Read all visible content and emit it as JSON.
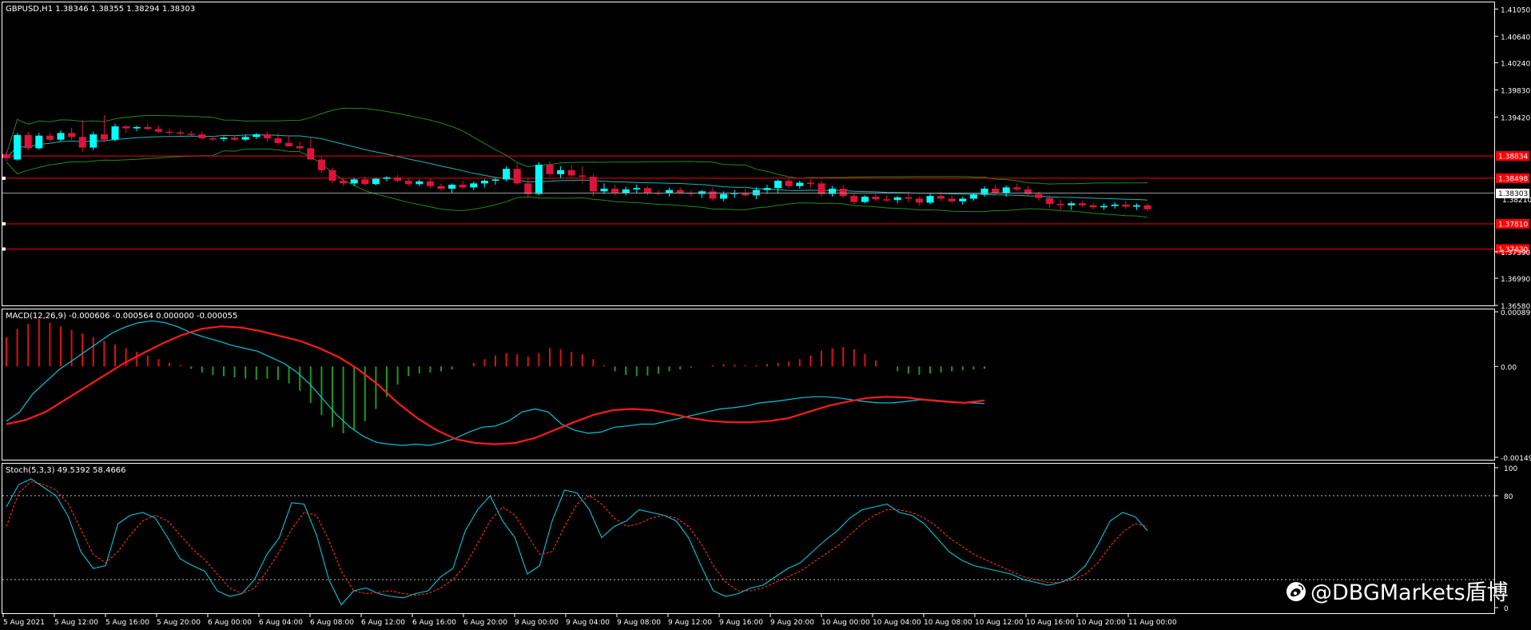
{
  "colors": {
    "bg": "#000000",
    "frame": "#ffffff",
    "bull": "#00ffff",
    "bear": "#dc143c",
    "bb": "#1f8a1f",
    "level": "#ff0000",
    "macd_main": "#00c8d8",
    "macd_signal": "#ff1a1a",
    "hist_pos": "#e01010",
    "hist_neg": "#1a9a1a",
    "stoch_main": "#00c8d8",
    "stoch_signal": "#ff2a2a"
  },
  "main_panel": {
    "header": "GBPUSD,H1  1.38346 1.38355 1.38294 1.38303",
    "price_ticks": [
      "1.41050",
      "1.40640",
      "1.40240",
      "1.39830",
      "1.39420",
      "1.37390",
      "1.36990",
      "1.36580"
    ],
    "current_price": "1.38303",
    "levels": [
      {
        "label": "1.38834",
        "price": 1.38834
      },
      {
        "label": "1.38498",
        "price": 1.38498
      },
      {
        "label": "1.37810",
        "price": 1.3781
      },
      {
        "label": "1.37430",
        "price": 1.3743
      }
    ],
    "hidden_tick": "1.38210"
  },
  "macd_panel": {
    "header": "MACD(12,26,9) -0.000606 -0.000564 0.000000 -0.000055",
    "ticks": [
      "0.000899",
      "0.00",
      "-0.001496"
    ]
  },
  "stoch_panel": {
    "header": "Stoch(5,3,3) 49.5392 58.4666",
    "ticks": [
      "100",
      "80",
      "0"
    ]
  },
  "time_axis": [
    "5 Aug 2021",
    "5 Aug 12:00",
    "5 Aug 16:00",
    "5 Aug 20:00",
    "6 Aug 00:00",
    "6 Aug 04:00",
    "6 Aug 08:00",
    "6 Aug 12:00",
    "6 Aug 16:00",
    "6 Aug 20:00",
    "9 Aug 00:00",
    "9 Aug 04:00",
    "9 Aug 08:00",
    "9 Aug 12:00",
    "9 Aug 16:00",
    "9 Aug 20:00",
    "10 Aug 00:00",
    "10 Aug 04:00",
    "10 Aug 08:00",
    "10 Aug 12:00",
    "10 Aug 16:00",
    "10 Aug 20:00",
    "11 Aug 00:00"
  ],
  "watermark": "@DBGMarkets盾博",
  "watermark_icon": "weibo-logo-icon",
  "chart_data": {
    "type": "candlestick",
    "symbol": "GBPUSD",
    "timeframe": "H1",
    "ylim": [
      1.3658,
      1.4115
    ],
    "candles": [
      [
        1.3886,
        1.389,
        1.3875,
        1.388
      ],
      [
        1.3878,
        1.3918,
        1.3876,
        1.3915
      ],
      [
        1.3915,
        1.392,
        1.3892,
        1.3895
      ],
      [
        1.3895,
        1.3918,
        1.3893,
        1.3914
      ],
      [
        1.3914,
        1.3918,
        1.3905,
        1.3908
      ],
      [
        1.3908,
        1.3922,
        1.3905,
        1.3918
      ],
      [
        1.3918,
        1.3926,
        1.3908,
        1.3912
      ],
      [
        1.3912,
        1.3938,
        1.389,
        1.3896
      ],
      [
        1.3896,
        1.392,
        1.3892,
        1.3916
      ],
      [
        1.3916,
        1.3945,
        1.3904,
        1.3908
      ],
      [
        1.3908,
        1.3932,
        1.3905,
        1.3928
      ],
      [
        1.3928,
        1.393,
        1.3918,
        1.3925
      ],
      [
        1.3925,
        1.3929,
        1.3921,
        1.3927
      ],
      [
        1.3927,
        1.3932,
        1.3922,
        1.3924
      ],
      [
        1.3924,
        1.3929,
        1.3918,
        1.392
      ],
      [
        1.392,
        1.3925,
        1.3915,
        1.3919
      ],
      [
        1.3919,
        1.3922,
        1.3914,
        1.3917
      ],
      [
        1.3917,
        1.3921,
        1.3913,
        1.3916
      ],
      [
        1.3916,
        1.392,
        1.3908,
        1.391
      ],
      [
        1.391,
        1.3913,
        1.3906,
        1.3909
      ],
      [
        1.3909,
        1.3913,
        1.3905,
        1.3911
      ],
      [
        1.3911,
        1.3914,
        1.3906,
        1.3908
      ],
      [
        1.3908,
        1.3915,
        1.3906,
        1.3912
      ],
      [
        1.3912,
        1.3918,
        1.3909,
        1.3916
      ],
      [
        1.3916,
        1.392,
        1.3905,
        1.391
      ],
      [
        1.391,
        1.3918,
        1.39,
        1.3903
      ],
      [
        1.3903,
        1.3915,
        1.39,
        1.3898
      ],
      [
        1.3898,
        1.3905,
        1.3892,
        1.3895
      ],
      [
        1.3895,
        1.3912,
        1.388,
        1.3878
      ],
      [
        1.3878,
        1.3882,
        1.3858,
        1.3862
      ],
      [
        1.3862,
        1.3866,
        1.3842,
        1.3846
      ],
      [
        1.3846,
        1.385,
        1.3838,
        1.3842
      ],
      [
        1.3842,
        1.385,
        1.3838,
        1.3848
      ],
      [
        1.3848,
        1.3852,
        1.3838,
        1.3841
      ],
      [
        1.3841,
        1.385,
        1.3839,
        1.3849
      ],
      [
        1.3849,
        1.3853,
        1.3845,
        1.3851
      ],
      [
        1.3851,
        1.3855,
        1.3844,
        1.3846
      ],
      [
        1.3846,
        1.385,
        1.3838,
        1.3841
      ],
      [
        1.3841,
        1.3848,
        1.3838,
        1.3845
      ],
      [
        1.3845,
        1.3849,
        1.3835,
        1.3838
      ],
      [
        1.3838,
        1.3842,
        1.3831,
        1.3834
      ],
      [
        1.3834,
        1.3842,
        1.3828,
        1.384
      ],
      [
        1.384,
        1.3846,
        1.3834,
        1.3836
      ],
      [
        1.3836,
        1.3845,
        1.3832,
        1.3842
      ],
      [
        1.3842,
        1.3848,
        1.3836,
        1.3846
      ],
      [
        1.3846,
        1.385,
        1.384,
        1.3848
      ],
      [
        1.3848,
        1.3868,
        1.3845,
        1.3864
      ],
      [
        1.3864,
        1.3872,
        1.384,
        1.3842
      ],
      [
        1.3842,
        1.385,
        1.382,
        1.3826
      ],
      [
        1.3826,
        1.3874,
        1.3824,
        1.387
      ],
      [
        1.387,
        1.3875,
        1.3852,
        1.3856
      ],
      [
        1.3856,
        1.3868,
        1.385,
        1.3862
      ],
      [
        1.3862,
        1.387,
        1.385,
        1.3854
      ],
      [
        1.3854,
        1.3868,
        1.3842,
        1.3852
      ],
      [
        1.3852,
        1.3856,
        1.3822,
        1.383
      ],
      [
        1.383,
        1.3842,
        1.3826,
        1.3834
      ],
      [
        1.3834,
        1.384,
        1.3824,
        1.3828
      ],
      [
        1.3828,
        1.3837,
        1.3824,
        1.3833
      ],
      [
        1.3833,
        1.384,
        1.3828,
        1.3835
      ],
      [
        1.3835,
        1.3838,
        1.3824,
        1.3828
      ],
      [
        1.3828,
        1.3832,
        1.3824,
        1.3827
      ],
      [
        1.3827,
        1.3836,
        1.3822,
        1.3832
      ],
      [
        1.3832,
        1.3836,
        1.3826,
        1.3828
      ],
      [
        1.3828,
        1.3832,
        1.3822,
        1.3826
      ],
      [
        1.3826,
        1.3832,
        1.382,
        1.383
      ],
      [
        1.383,
        1.3836,
        1.3816,
        1.3819
      ],
      [
        1.3819,
        1.383,
        1.3815,
        1.3826
      ],
      [
        1.3826,
        1.3832,
        1.382,
        1.3828
      ],
      [
        1.3828,
        1.3834,
        1.3822,
        1.3824
      ],
      [
        1.3824,
        1.3836,
        1.3818,
        1.3832
      ],
      [
        1.3832,
        1.384,
        1.3826,
        1.3835
      ],
      [
        1.3835,
        1.3848,
        1.3828,
        1.3846
      ],
      [
        1.3846,
        1.385,
        1.3834,
        1.3838
      ],
      [
        1.3838,
        1.3846,
        1.3834,
        1.3843
      ],
      [
        1.3843,
        1.3848,
        1.3836,
        1.3842
      ],
      [
        1.3842,
        1.3846,
        1.3822,
        1.3826
      ],
      [
        1.3826,
        1.3838,
        1.3822,
        1.3834
      ],
      [
        1.3834,
        1.384,
        1.382,
        1.3823
      ],
      [
        1.3823,
        1.3826,
        1.381,
        1.3814
      ],
      [
        1.3814,
        1.3824,
        1.3812,
        1.3822
      ],
      [
        1.3822,
        1.3826,
        1.3815,
        1.3818
      ],
      [
        1.3818,
        1.3824,
        1.3814,
        1.3817
      ],
      [
        1.3817,
        1.3823,
        1.3812,
        1.3821
      ],
      [
        1.3821,
        1.383,
        1.3814,
        1.3819
      ],
      [
        1.3819,
        1.3822,
        1.3808,
        1.3813
      ],
      [
        1.3813,
        1.3827,
        1.381,
        1.3823
      ],
      [
        1.3823,
        1.383,
        1.3815,
        1.3819
      ],
      [
        1.3819,
        1.3824,
        1.3812,
        1.3815
      ],
      [
        1.3815,
        1.3822,
        1.381,
        1.3819
      ],
      [
        1.3819,
        1.3828,
        1.3816,
        1.3825
      ],
      [
        1.3825,
        1.3838,
        1.3822,
        1.3834
      ],
      [
        1.3834,
        1.384,
        1.3824,
        1.3827
      ],
      [
        1.3827,
        1.3839,
        1.3822,
        1.3836
      ],
      [
        1.3836,
        1.3842,
        1.383,
        1.3833
      ],
      [
        1.3833,
        1.3838,
        1.3822,
        1.3826
      ],
      [
        1.3826,
        1.383,
        1.3816,
        1.382
      ],
      [
        1.382,
        1.3824,
        1.3806,
        1.3811
      ],
      [
        1.3811,
        1.3818,
        1.3802,
        1.3809
      ],
      [
        1.3809,
        1.3815,
        1.3802,
        1.3812
      ],
      [
        1.3812,
        1.3816,
        1.3806,
        1.3809
      ],
      [
        1.3809,
        1.3813,
        1.3803,
        1.3806
      ],
      [
        1.3806,
        1.3812,
        1.3802,
        1.3808
      ],
      [
        1.3808,
        1.3814,
        1.3804,
        1.381
      ],
      [
        1.381,
        1.3816,
        1.3804,
        1.3807
      ],
      [
        1.3807,
        1.3812,
        1.3802,
        1.3809
      ],
      [
        1.3809,
        1.3812,
        1.38,
        1.3803
      ]
    ],
    "macd_histogram": [
      0.00048,
      0.00062,
      0.0007,
      0.00078,
      0.00072,
      0.00066,
      0.0006,
      0.00054,
      0.00048,
      0.00042,
      0.00036,
      0.0003,
      0.00024,
      0.00018,
      0.00012,
      6e-05,
      2e-05,
      -4e-05,
      -0.0001,
      -0.00014,
      -0.00016,
      -0.00018,
      -0.0002,
      -0.00022,
      -0.0002,
      -0.00022,
      -0.00028,
      -0.0004,
      -0.0006,
      -0.0008,
      -0.001,
      -0.0011,
      -0.00105,
      -0.0009,
      -0.0007,
      -0.0005,
      -0.0003,
      -0.00016,
      -0.00012,
      -0.0001,
      -8e-05,
      -5e-05,
      0.0,
      6e-05,
      0.00012,
      0.00018,
      0.00022,
      0.0002,
      0.00016,
      0.00022,
      0.0003,
      0.00028,
      0.00024,
      0.0002,
      0.00012,
      2e-05,
      -8e-05,
      -0.00014,
      -0.00016,
      -0.00015,
      -0.00012,
      -8e-05,
      -5e-05,
      -2e-05,
      0.0,
      2e-05,
      4e-05,
      3e-05,
      2e-05,
      2e-05,
      4e-05,
      6e-05,
      8e-05,
      0.00012,
      0.00018,
      0.00026,
      0.0003,
      0.00032,
      0.00028,
      0.0002,
      0.0001,
      0.0,
      -8e-05,
      -0.00012,
      -0.00014,
      -0.00012,
      -0.0001,
      -8e-05,
      -6e-05,
      -5e-05,
      -4e-05
    ],
    "macd_main": [
      -0.0009,
      -0.00075,
      -0.00045,
      -0.00025,
      -5e-05,
      0.0001,
      0.00025,
      0.0004,
      0.00055,
      0.00065,
      0.00072,
      0.00075,
      0.00072,
      0.00065,
      0.00055,
      0.00048,
      0.00042,
      0.00035,
      0.0003,
      0.00025,
      0.00015,
      5e-05,
      -0.0001,
      -0.0003,
      -0.00055,
      -0.0008,
      -0.001,
      -0.00115,
      -0.00125,
      -0.00128,
      -0.0013,
      -0.00128,
      -0.0013,
      -0.00125,
      -0.00118,
      -0.00108,
      -0.001,
      -0.00098,
      -0.0009,
      -0.00075,
      -0.0007,
      -0.00075,
      -0.00095,
      -0.00105,
      -0.0011,
      -0.00108,
      -0.001,
      -0.00098,
      -0.00095,
      -0.00095,
      -0.0009,
      -0.00085,
      -0.0008,
      -0.00075,
      -0.0007,
      -0.00068,
      -0.00065,
      -0.0006,
      -0.00058,
      -0.00055,
      -0.00052,
      -0.0005,
      -0.0005,
      -0.00052,
      -0.00055,
      -0.00058,
      -0.0006,
      -0.0006,
      -0.00058,
      -0.00055,
      -0.00055,
      -0.00057,
      -0.00059,
      -0.0006,
      -0.00061
    ],
    "macd_signal": [
      -0.00095,
      -0.00088,
      -0.00075,
      -0.00055,
      -0.00035,
      -0.00015,
      5e-05,
      0.00022,
      0.00038,
      0.00052,
      0.00062,
      0.00066,
      0.00064,
      0.00058,
      0.0005,
      0.00042,
      0.0003,
      0.00015,
      -5e-05,
      -0.0003,
      -0.0006,
      -0.00085,
      -0.00105,
      -0.0012,
      -0.00126,
      -0.00128,
      -0.00126,
      -0.00118,
      -0.00105,
      -0.00092,
      -0.0008,
      -0.00072,
      -0.0007,
      -0.00072,
      -0.00078,
      -0.00085,
      -0.0009,
      -0.00092,
      -0.00092,
      -0.0009,
      -0.00085,
      -0.00075,
      -0.00065,
      -0.00058,
      -0.00052,
      -0.0005,
      -0.00051,
      -0.00055,
      -0.00058,
      -0.0006,
      -0.00056
    ],
    "stoch_main": [
      72,
      88,
      92,
      86,
      80,
      65,
      40,
      28,
      30,
      60,
      66,
      68,
      64,
      50,
      35,
      30,
      26,
      12,
      8,
      10,
      20,
      38,
      50,
      75,
      74,
      52,
      20,
      2,
      12,
      14,
      10,
      8,
      7,
      10,
      12,
      22,
      28,
      55,
      70,
      80,
      62,
      50,
      24,
      30,
      62,
      84,
      82,
      70,
      50,
      58,
      62,
      70,
      68,
      66,
      62,
      50,
      30,
      12,
      8,
      10,
      14,
      16,
      22,
      28,
      32,
      40,
      48,
      55,
      64,
      70,
      72,
      74,
      68,
      66,
      60,
      50,
      40,
      34,
      30,
      28,
      26,
      24,
      20,
      18,
      16,
      18,
      22,
      30,
      45,
      62,
      68,
      65,
      55
    ],
    "stoch_signal": [
      58,
      82,
      90,
      88,
      84,
      74,
      56,
      38,
      32,
      40,
      52,
      62,
      66,
      62,
      52,
      42,
      34,
      24,
      14,
      10,
      14,
      26,
      40,
      56,
      68,
      66,
      48,
      26,
      12,
      10,
      11,
      12,
      10,
      9,
      10,
      14,
      20,
      30,
      46,
      62,
      72,
      66,
      52,
      38,
      40,
      58,
      74,
      80,
      74,
      64,
      58,
      60,
      64,
      66,
      64,
      58,
      46,
      30,
      18,
      12,
      12,
      14,
      18,
      22,
      26,
      32,
      38,
      44,
      52,
      60,
      66,
      70,
      70,
      68,
      64,
      58,
      50,
      44,
      38,
      34,
      30,
      26,
      22,
      20,
      18,
      18,
      20,
      24,
      32,
      44,
      54,
      60,
      58
    ]
  }
}
